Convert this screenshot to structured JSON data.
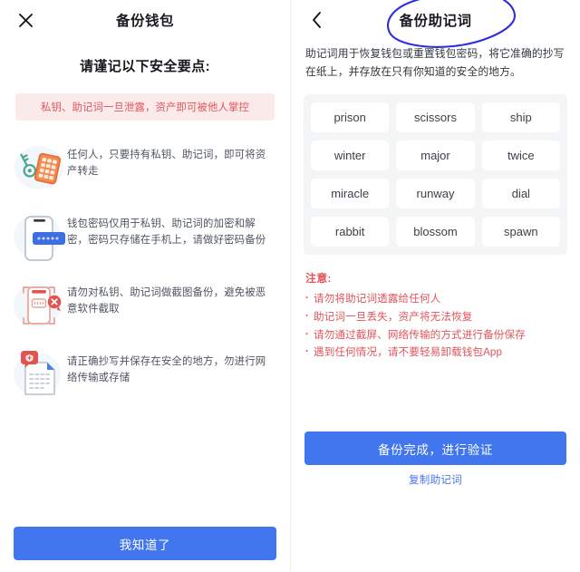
{
  "colors": {
    "accent_blue": "#4276ef",
    "warn_red": "#e2555c",
    "warn_bg": "#fbeaea",
    "grid_bg": "#f4f5f7",
    "annotation_blue": "#2d2ee0"
  },
  "left": {
    "close_icon": "close-x-icon",
    "title": "备份钱包",
    "section_title": "请谨记以下安全要点:",
    "warning_banner": "私钥、助记词一旦泄露，资产即可被他人掌控",
    "tips": [
      {
        "icon": "key-and-keypad-icon",
        "text": "任何人，只要持有私钥、助记词，即可将资产转走"
      },
      {
        "icon": "phone-password-icon",
        "text": "钱包密码仅用于私钥、助记词的加密和解密，密码只存储在手机上，请做好密码备份"
      },
      {
        "icon": "no-screenshot-icon",
        "text": "请勿对私钥、助记词做截图备份，避免被恶意软件截取"
      },
      {
        "icon": "secure-document-icon",
        "text": "请正确抄写并保存在安全的地方，勿进行网络传输或存储"
      }
    ],
    "confirm_button": "我知道了"
  },
  "right": {
    "back_icon": "back-chevron-icon",
    "title": "备份助记词",
    "annotation": "hand-drawn-blue-circle",
    "intro": "助记词用于恢复钱包或重置钱包密码，将它准确的抄写在纸上，并存放在只有你知道的安全的地方。",
    "mnemonic_words": [
      "prison",
      "scissors",
      "ship",
      "winter",
      "major",
      "twice",
      "miracle",
      "runway",
      "dial",
      "rabbit",
      "blossom",
      "spawn"
    ],
    "notes_heading": "注意:",
    "notes": [
      "请勿将助记词透露给任何人",
      "助记词一旦丢失，资产将无法恢复",
      "请勿通过截屏、网络传输的方式进行备份保存",
      "遇到任何情况，请不要轻易卸载钱包App"
    ],
    "verify_button": "备份完成，进行验证",
    "copy_link": "复制助记词"
  }
}
